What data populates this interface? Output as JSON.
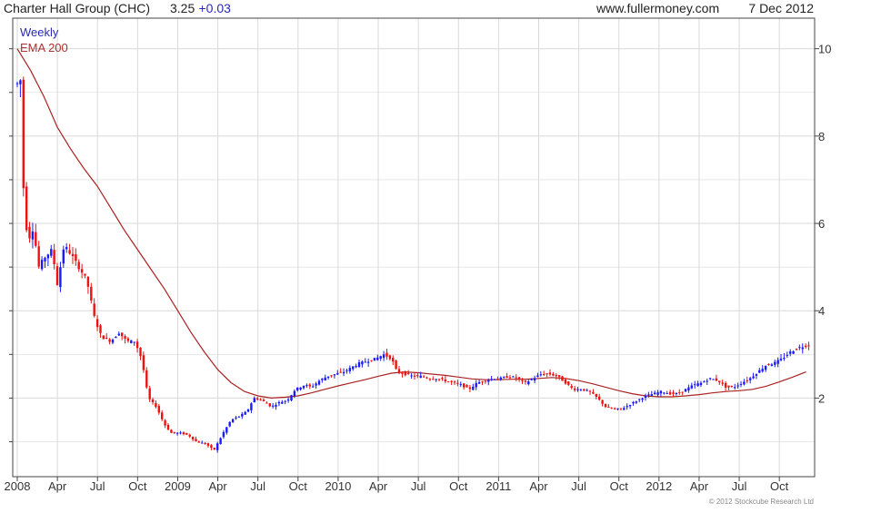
{
  "header": {
    "title": "Charter Hall Group (CHC)",
    "price": "3.25",
    "change": "+0.03",
    "site": "www.fullermoney.com",
    "date": "7 Dec 2012"
  },
  "legend": {
    "period": "Weekly",
    "indicator": "EMA 200"
  },
  "footer": {
    "copyright": "© 2012 Stockcube Research Ltd"
  },
  "colors": {
    "up": "#1a1aff",
    "down": "#ee1111",
    "ema": "#aa2222",
    "grid": "#d9d9d9",
    "period_text": "#2a2ab0",
    "indicator_text": "#aa3333"
  },
  "chart_data": {
    "type": "candlestick",
    "xlabel": "",
    "ylabel": "",
    "ylim": [
      0.2,
      10.7
    ],
    "y_ticks": [
      2,
      4,
      6,
      8,
      10
    ],
    "x_ticks": [
      {
        "label": "2008",
        "t": 0
      },
      {
        "label": "Apr",
        "t": 3
      },
      {
        "label": "Jul",
        "t": 6
      },
      {
        "label": "Oct",
        "t": 9
      },
      {
        "label": "2009",
        "t": 12
      },
      {
        "label": "Apr",
        "t": 15
      },
      {
        "label": "Jul",
        "t": 18
      },
      {
        "label": "Oct",
        "t": 21
      },
      {
        "label": "2010",
        "t": 24
      },
      {
        "label": "Apr",
        "t": 27
      },
      {
        "label": "Jul",
        "t": 30
      },
      {
        "label": "Oct",
        "t": 33
      },
      {
        "label": "2011",
        "t": 36
      },
      {
        "label": "Apr",
        "t": 39
      },
      {
        "label": "Jul",
        "t": 42
      },
      {
        "label": "Oct",
        "t": 45
      },
      {
        "label": "2012",
        "t": 48
      },
      {
        "label": "Apr",
        "t": 51
      },
      {
        "label": "Jul",
        "t": 54
      },
      {
        "label": "Oct",
        "t": 57
      }
    ],
    "x_end": 59.3,
    "price_path": [
      [
        0.0,
        9.2
      ],
      [
        0.2,
        9.6
      ],
      [
        0.5,
        6.4
      ],
      [
        0.8,
        5.6
      ],
      [
        1.2,
        5.9
      ],
      [
        1.6,
        5.0
      ],
      [
        2.0,
        5.2
      ],
      [
        2.6,
        5.4
      ],
      [
        3.0,
        4.6
      ],
      [
        3.5,
        5.5
      ],
      [
        4.0,
        5.3
      ],
      [
        4.6,
        5.0
      ],
      [
        5.2,
        4.7
      ],
      [
        5.8,
        3.8
      ],
      [
        6.3,
        3.4
      ],
      [
        7.0,
        3.3
      ],
      [
        7.6,
        3.5
      ],
      [
        8.2,
        3.3
      ],
      [
        8.8,
        3.3
      ],
      [
        9.3,
        2.9
      ],
      [
        9.8,
        2.0
      ],
      [
        10.4,
        1.8
      ],
      [
        11.0,
        1.4
      ],
      [
        11.5,
        1.2
      ],
      [
        12.2,
        1.2
      ],
      [
        12.8,
        1.15
      ],
      [
        13.4,
        1.0
      ],
      [
        14.1,
        0.95
      ],
      [
        14.7,
        0.8
      ],
      [
        15.4,
        1.2
      ],
      [
        16.0,
        1.5
      ],
      [
        16.7,
        1.6
      ],
      [
        17.2,
        1.7
      ],
      [
        17.7,
        2.0
      ],
      [
        18.3,
        1.95
      ],
      [
        19.0,
        1.8
      ],
      [
        19.6,
        1.9
      ],
      [
        20.2,
        1.95
      ],
      [
        20.8,
        2.2
      ],
      [
        21.5,
        2.3
      ],
      [
        22.0,
        2.25
      ],
      [
        22.6,
        2.4
      ],
      [
        23.2,
        2.5
      ],
      [
        23.8,
        2.55
      ],
      [
        24.4,
        2.6
      ],
      [
        25.0,
        2.7
      ],
      [
        25.6,
        2.8
      ],
      [
        26.2,
        2.85
      ],
      [
        26.8,
        2.9
      ],
      [
        27.4,
        3.0
      ],
      [
        28.0,
        2.9
      ],
      [
        28.4,
        2.6
      ],
      [
        29.0,
        2.55
      ],
      [
        29.6,
        2.5
      ],
      [
        30.2,
        2.5
      ],
      [
        30.8,
        2.45
      ],
      [
        31.4,
        2.45
      ],
      [
        32.0,
        2.4
      ],
      [
        32.6,
        2.35
      ],
      [
        33.2,
        2.3
      ],
      [
        33.8,
        2.2
      ],
      [
        34.4,
        2.35
      ],
      [
        35.0,
        2.4
      ],
      [
        35.6,
        2.45
      ],
      [
        36.2,
        2.45
      ],
      [
        36.8,
        2.5
      ],
      [
        37.4,
        2.45
      ],
      [
        38.0,
        2.35
      ],
      [
        38.6,
        2.45
      ],
      [
        39.2,
        2.55
      ],
      [
        39.8,
        2.55
      ],
      [
        40.4,
        2.5
      ],
      [
        41.0,
        2.35
      ],
      [
        41.6,
        2.2
      ],
      [
        42.2,
        2.2
      ],
      [
        42.8,
        2.15
      ],
      [
        43.4,
        2.0
      ],
      [
        44.0,
        1.8
      ],
      [
        44.6,
        1.75
      ],
      [
        45.2,
        1.75
      ],
      [
        45.8,
        1.85
      ],
      [
        46.4,
        1.95
      ],
      [
        47.0,
        2.05
      ],
      [
        47.6,
        2.1
      ],
      [
        48.2,
        2.15
      ],
      [
        48.8,
        2.1
      ],
      [
        49.4,
        2.1
      ],
      [
        50.0,
        2.2
      ],
      [
        50.6,
        2.3
      ],
      [
        51.2,
        2.35
      ],
      [
        51.8,
        2.45
      ],
      [
        52.4,
        2.4
      ],
      [
        53.0,
        2.25
      ],
      [
        53.6,
        2.25
      ],
      [
        54.2,
        2.35
      ],
      [
        54.8,
        2.45
      ],
      [
        55.4,
        2.6
      ],
      [
        56.0,
        2.75
      ],
      [
        56.6,
        2.8
      ],
      [
        57.2,
        2.9
      ],
      [
        57.8,
        3.05
      ],
      [
        58.4,
        3.15
      ],
      [
        59.2,
        3.22
      ]
    ],
    "series": [
      {
        "name": "EMA 200",
        "points": [
          [
            0.0,
            10.0
          ],
          [
            1.0,
            9.5
          ],
          [
            2.0,
            8.9
          ],
          [
            3.0,
            8.2
          ],
          [
            4.0,
            7.7
          ],
          [
            5.0,
            7.25
          ],
          [
            6.0,
            6.85
          ],
          [
            7.0,
            6.35
          ],
          [
            8.0,
            5.85
          ],
          [
            9.0,
            5.4
          ],
          [
            10.0,
            4.95
          ],
          [
            11.0,
            4.5
          ],
          [
            12.0,
            4.0
          ],
          [
            13.0,
            3.5
          ],
          [
            14.0,
            3.05
          ],
          [
            15.0,
            2.65
          ],
          [
            16.0,
            2.35
          ],
          [
            17.0,
            2.15
          ],
          [
            18.0,
            2.05
          ],
          [
            19.0,
            2.0
          ],
          [
            20.0,
            2.02
          ],
          [
            21.0,
            2.05
          ],
          [
            22.0,
            2.12
          ],
          [
            23.0,
            2.2
          ],
          [
            24.0,
            2.28
          ],
          [
            25.0,
            2.35
          ],
          [
            26.0,
            2.42
          ],
          [
            27.0,
            2.5
          ],
          [
            28.0,
            2.57
          ],
          [
            29.0,
            2.6
          ],
          [
            30.0,
            2.58
          ],
          [
            31.0,
            2.55
          ],
          [
            32.0,
            2.52
          ],
          [
            33.0,
            2.48
          ],
          [
            34.0,
            2.44
          ],
          [
            35.0,
            2.42
          ],
          [
            36.0,
            2.42
          ],
          [
            37.0,
            2.43
          ],
          [
            38.0,
            2.43
          ],
          [
            39.0,
            2.45
          ],
          [
            40.0,
            2.47
          ],
          [
            41.0,
            2.45
          ],
          [
            42.0,
            2.4
          ],
          [
            43.0,
            2.33
          ],
          [
            44.0,
            2.25
          ],
          [
            45.0,
            2.17
          ],
          [
            46.0,
            2.1
          ],
          [
            47.0,
            2.05
          ],
          [
            48.0,
            2.03
          ],
          [
            49.0,
            2.03
          ],
          [
            50.0,
            2.05
          ],
          [
            51.0,
            2.08
          ],
          [
            52.0,
            2.12
          ],
          [
            53.0,
            2.15
          ],
          [
            54.0,
            2.17
          ],
          [
            55.0,
            2.2
          ],
          [
            56.0,
            2.27
          ],
          [
            57.0,
            2.37
          ],
          [
            58.0,
            2.48
          ],
          [
            59.0,
            2.6
          ]
        ]
      }
    ],
    "grid": true
  }
}
